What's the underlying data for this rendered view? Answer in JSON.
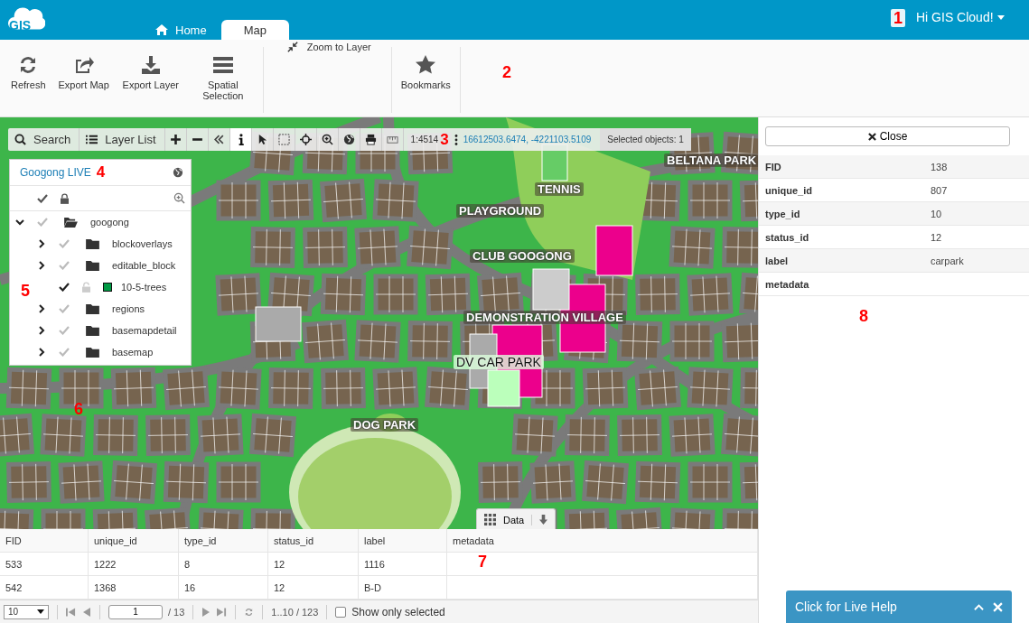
{
  "header": {
    "logo": "GIS",
    "tabs": [
      {
        "label": "Home",
        "selected": false
      },
      {
        "label": "Map",
        "selected": true
      }
    ],
    "annotation": "1",
    "user": "Hi GIS Cloud!"
  },
  "ribbon": {
    "groups": [
      {
        "kind": "large",
        "items": [
          "Refresh",
          "Export Map",
          "Export Layer",
          "Spatial Selection"
        ]
      },
      {
        "kind": "small",
        "items": [
          "Zoom to Layer"
        ]
      },
      {
        "kind": "large",
        "items": [
          "Bookmarks"
        ]
      }
    ],
    "annotation": "2"
  },
  "map": {
    "labels": [
      {
        "text": "BELTANA PARK",
        "dark": false
      },
      {
        "text": "TENNIS",
        "dark": false
      },
      {
        "text": "PLAYGROUND",
        "dark": false
      },
      {
        "text": "CLUB GOOGONG",
        "dark": false
      },
      {
        "text": "DEMONSTRATION VILLAGE",
        "dark": false
      },
      {
        "text": "DV CAR PARK",
        "dark": true
      },
      {
        "text": "DOG PARK",
        "dark": false
      }
    ],
    "annotation": "6",
    "data_tab": "Data"
  },
  "toolbar": {
    "search": "Search",
    "layer_list": "Layer List",
    "tools": [
      {
        "selected": false
      },
      {
        "selected": false
      },
      {
        "selected": false
      },
      {
        "selected": true
      },
      {
        "selected": false
      },
      {
        "selected": false
      },
      {
        "selected": false
      },
      {
        "selected": false
      },
      {
        "selected": false
      },
      {
        "selected": false
      },
      {
        "selected": false
      }
    ],
    "scale": "1:4514",
    "annotation": "3",
    "coordinates": "16612503.6474, -4221103.5109",
    "selected_objects": "Selected objects: 1"
  },
  "layer_panel": {
    "title": "Googong LIVE",
    "annotation": "4",
    "side_annotation": "5",
    "tree": [
      {
        "kind": "folder",
        "name": "googong",
        "expanded": true,
        "checked": false,
        "children": [
          {
            "kind": "folder",
            "name": "blockoverlays",
            "expanded": false,
            "checked": false
          },
          {
            "kind": "folder",
            "name": "editable_block",
            "expanded": false,
            "checked": false
          },
          {
            "kind": "layer",
            "name": "10-5-trees",
            "checked": true,
            "locked": false,
            "color": "#009a44"
          },
          {
            "kind": "folder",
            "name": "regions",
            "expanded": false,
            "checked": false
          },
          {
            "kind": "folder",
            "name": "basemapdetail",
            "expanded": false,
            "checked": false
          },
          {
            "kind": "folder",
            "name": "basemap",
            "expanded": false,
            "checked": false
          }
        ]
      }
    ]
  },
  "info_panel": {
    "close": "Close",
    "annotation": "8",
    "properties": [
      {
        "name": "FID",
        "value": "138"
      },
      {
        "name": "unique_id",
        "value": "807"
      },
      {
        "name": "type_id",
        "value": "10"
      },
      {
        "name": "status_id",
        "value": "12"
      },
      {
        "name": "label",
        "value": "carpark"
      },
      {
        "name": "metadata"
      }
    ]
  },
  "table": {
    "columns": [
      "FID",
      "unique_id",
      "type_id",
      "status_id",
      "label",
      "metadata"
    ],
    "annotation": "7",
    "rows": [
      [
        "533",
        "1222",
        "8",
        "12",
        "1116"
      ],
      [
        "542",
        "1368",
        "16",
        "12",
        "B-D"
      ]
    ],
    "pager": {
      "page_size": "10",
      "page": "1",
      "pages": "/ 13",
      "range": "1..10 / 123",
      "only_selected": {
        "label": "Show only selected",
        "checked": false
      }
    }
  },
  "live_help": {
    "label": "Click for Live Help"
  }
}
